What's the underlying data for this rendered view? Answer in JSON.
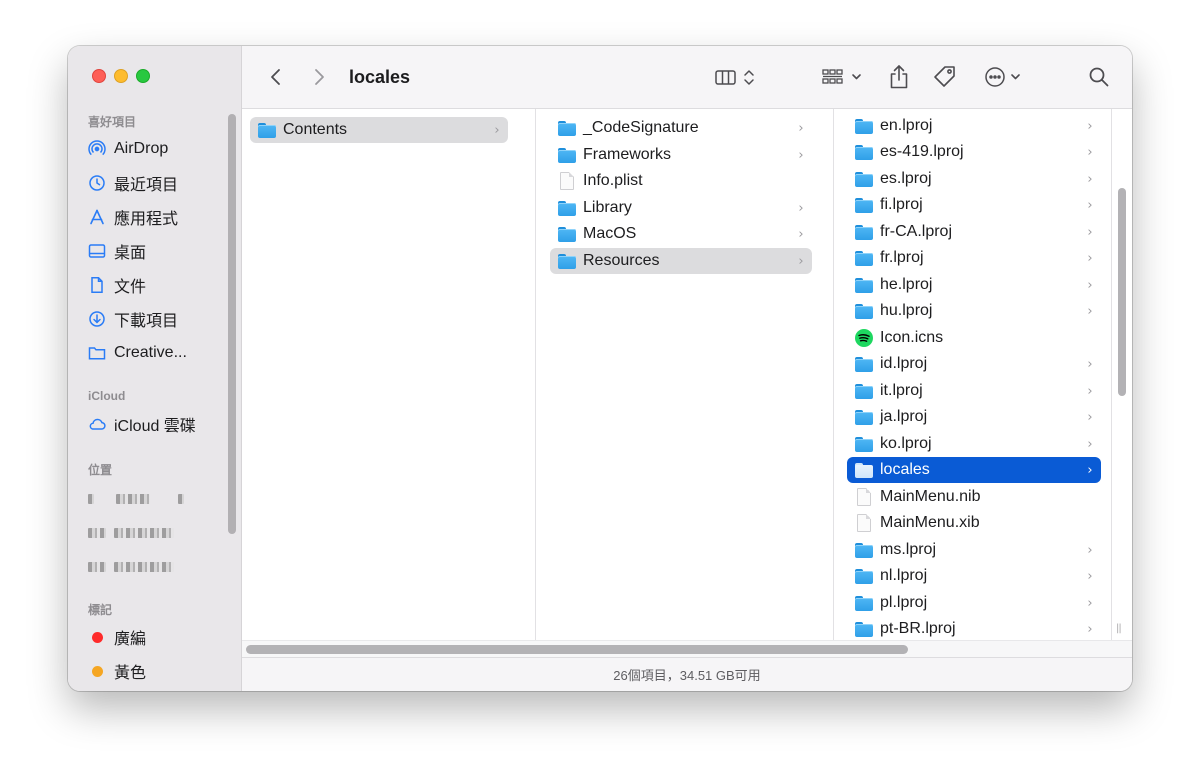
{
  "window": {
    "title": "locales",
    "status": "26個項目，34.51 GB可用"
  },
  "sidebar": {
    "favorites_header": "喜好項目",
    "favorites": [
      {
        "label": "AirDrop",
        "icon": "airdrop-icon"
      },
      {
        "label": "最近項目",
        "icon": "clock-icon"
      },
      {
        "label": "應用程式",
        "icon": "applications-icon"
      },
      {
        "label": "桌面",
        "icon": "desktop-icon"
      },
      {
        "label": "文件",
        "icon": "document-icon"
      },
      {
        "label": "下載項目",
        "icon": "download-icon"
      },
      {
        "label": "Creative...",
        "icon": "folder-icon"
      }
    ],
    "icloud_header": "iCloud",
    "icloud_items": [
      {
        "label": "iCloud 雲碟",
        "icon": "cloud-icon"
      }
    ],
    "locations_header": "位置",
    "tags_header": "標記",
    "tags": [
      {
        "label": "廣編",
        "color": "#fe2b2b"
      },
      {
        "label": "黃色",
        "color": "#f5a623"
      }
    ]
  },
  "toolbar": {
    "back_icon": "chevron-left-icon",
    "forward_icon": "chevron-right-icon",
    "view_icon": "column-view-icon",
    "group_icon": "group-by-icon",
    "share_icon": "share-icon",
    "tag_icon": "tag-icon",
    "more_icon": "ellipsis-circle-icon",
    "search_icon": "search-icon"
  },
  "columns": [
    {
      "items": [
        {
          "name": "Contents",
          "type": "folder",
          "has_children": true,
          "selected": "gray"
        }
      ]
    },
    {
      "items": [
        {
          "name": "_CodeSignature",
          "type": "folder",
          "has_children": true
        },
        {
          "name": "Frameworks",
          "type": "folder",
          "has_children": true
        },
        {
          "name": "Info.plist",
          "type": "file",
          "has_children": false
        },
        {
          "name": "Library",
          "type": "folder",
          "has_children": true
        },
        {
          "name": "MacOS",
          "type": "folder",
          "has_children": true
        },
        {
          "name": "Resources",
          "type": "folder",
          "has_children": true,
          "selected": "gray"
        }
      ]
    },
    {
      "items": [
        {
          "name": "en.lproj",
          "type": "folder",
          "has_children": true
        },
        {
          "name": "es-419.lproj",
          "type": "folder",
          "has_children": true
        },
        {
          "name": "es.lproj",
          "type": "folder",
          "has_children": true
        },
        {
          "name": "fi.lproj",
          "type": "folder",
          "has_children": true
        },
        {
          "name": "fr-CA.lproj",
          "type": "folder",
          "has_children": true
        },
        {
          "name": "fr.lproj",
          "type": "folder",
          "has_children": true
        },
        {
          "name": "he.lproj",
          "type": "folder",
          "has_children": true
        },
        {
          "name": "hu.lproj",
          "type": "folder",
          "has_children": true
        },
        {
          "name": "Icon.icns",
          "type": "spotify",
          "has_children": false
        },
        {
          "name": "id.lproj",
          "type": "folder",
          "has_children": true
        },
        {
          "name": "it.lproj",
          "type": "folder",
          "has_children": true
        },
        {
          "name": "ja.lproj",
          "type": "folder",
          "has_children": true
        },
        {
          "name": "ko.lproj",
          "type": "folder",
          "has_children": true
        },
        {
          "name": "locales",
          "type": "folder",
          "has_children": true,
          "selected": "blue"
        },
        {
          "name": "MainMenu.nib",
          "type": "file",
          "has_children": false
        },
        {
          "name": "MainMenu.xib",
          "type": "file",
          "has_children": false
        },
        {
          "name": "ms.lproj",
          "type": "folder",
          "has_children": true
        },
        {
          "name": "nl.lproj",
          "type": "folder",
          "has_children": true
        },
        {
          "name": "pl.lproj",
          "type": "folder",
          "has_children": true
        },
        {
          "name": "pt-BR.lproj",
          "type": "folder",
          "has_children": true
        }
      ]
    }
  ],
  "chevron_glyph": "›",
  "handle_glyph": "||"
}
